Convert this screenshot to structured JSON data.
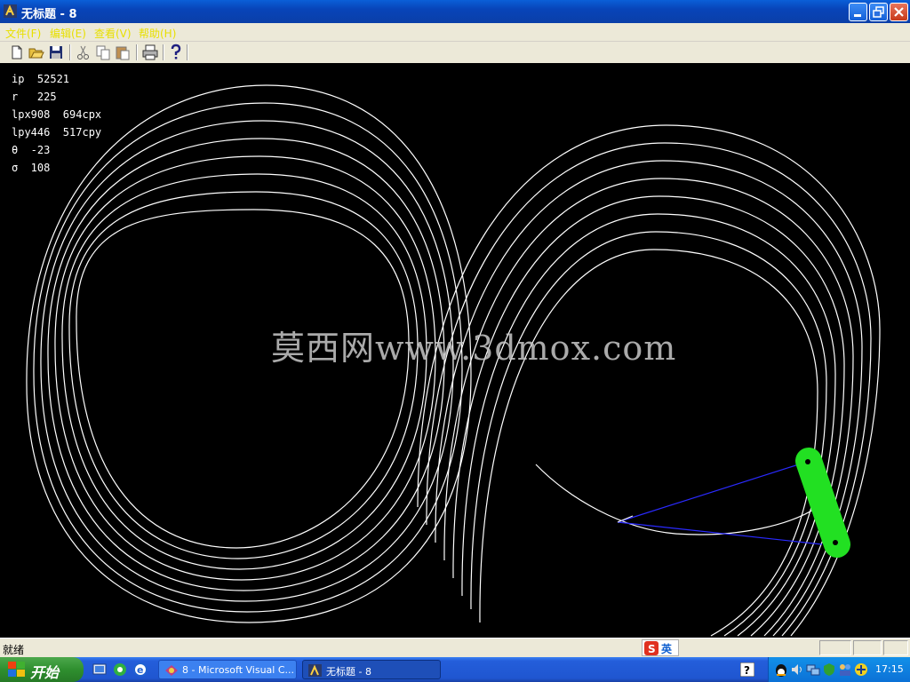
{
  "window": {
    "title": "无标题 - 8"
  },
  "menu": [
    "文件(F)",
    "编辑(E)",
    "查看(V)",
    "帮助(H)"
  ],
  "toolbar": {
    "new": "new-file-icon",
    "open": "open-folder-icon",
    "save": "save-icon",
    "cut": "cut-icon",
    "copy": "copy-icon",
    "paste": "paste-icon",
    "print": "print-icon",
    "help": "help-icon"
  },
  "readout": {
    "ip": "ip  52521",
    "r": "r   225",
    "lpx": "lpx908  694cpx",
    "lpy": "lpy446  517cpy",
    "theta": "θ  -23",
    "sigma": "σ  108"
  },
  "watermark": "莫西网www.3dmox.com",
  "status": {
    "text": "就绪",
    "ime_label": "英"
  },
  "taskbar": {
    "start_label": "开始",
    "tasks": [
      "8 - Microsoft Visual C...",
      "无标题 - 8"
    ],
    "clock": "17:15"
  },
  "colors": {
    "canvas": "#000000",
    "curve": "#ffffff",
    "capsule": "#22e022",
    "link": "#2a2aff",
    "menu_text": "#e8e000"
  }
}
